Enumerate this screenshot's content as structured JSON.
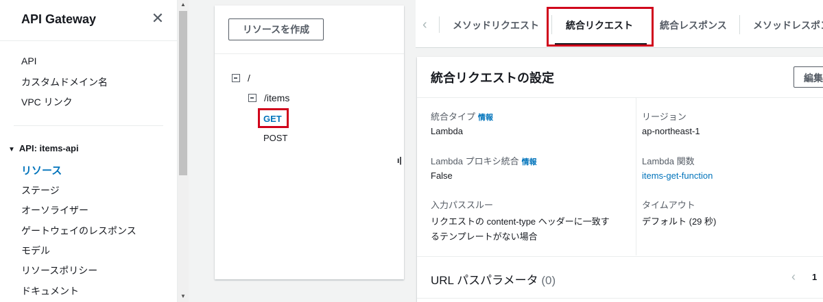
{
  "sidebar": {
    "title": "API Gateway",
    "links": [
      "API",
      "カスタムドメイン名",
      "VPC リンク"
    ],
    "section": "API: items-api",
    "active_item": "リソース",
    "items": [
      "ステージ",
      "オーソライザー",
      "ゲートウェイのレスポンス",
      "モデル",
      "リソースポリシー",
      "ドキュメント"
    ]
  },
  "resources": {
    "create_button": "リソースを作成",
    "root": "/",
    "child": "/items",
    "methods": [
      "GET",
      "POST"
    ]
  },
  "tabs": {
    "items": [
      "メソッドリクエスト",
      "統合リクエスト",
      "統合レスポンス",
      "メソッドレスポンス"
    ],
    "active": "統合リクエスト"
  },
  "settings": {
    "title": "統合リクエストの設定",
    "edit_button": "編集",
    "info_label": "情報",
    "fields": {
      "integration_type_label": "統合タイプ",
      "integration_type_value": "Lambda",
      "region_label": "リージョン",
      "region_value": "ap-northeast-1",
      "proxy_label": "Lambda プロキシ統合",
      "proxy_value": "False",
      "function_label": "Lambda 関数",
      "function_value": "items-get-function",
      "passthrough_label": "入力パススルー",
      "passthrough_value_line1": "リクエストの content-type ヘッダーに一致す",
      "passthrough_value_line2": "るテンプレートがない場合",
      "timeout_label": "タイムアウト",
      "timeout_value": "デフォルト (29 秒)"
    },
    "url_params_title": "URL パスパラメータ",
    "url_params_count": "(0)",
    "pager_page": "1"
  }
}
